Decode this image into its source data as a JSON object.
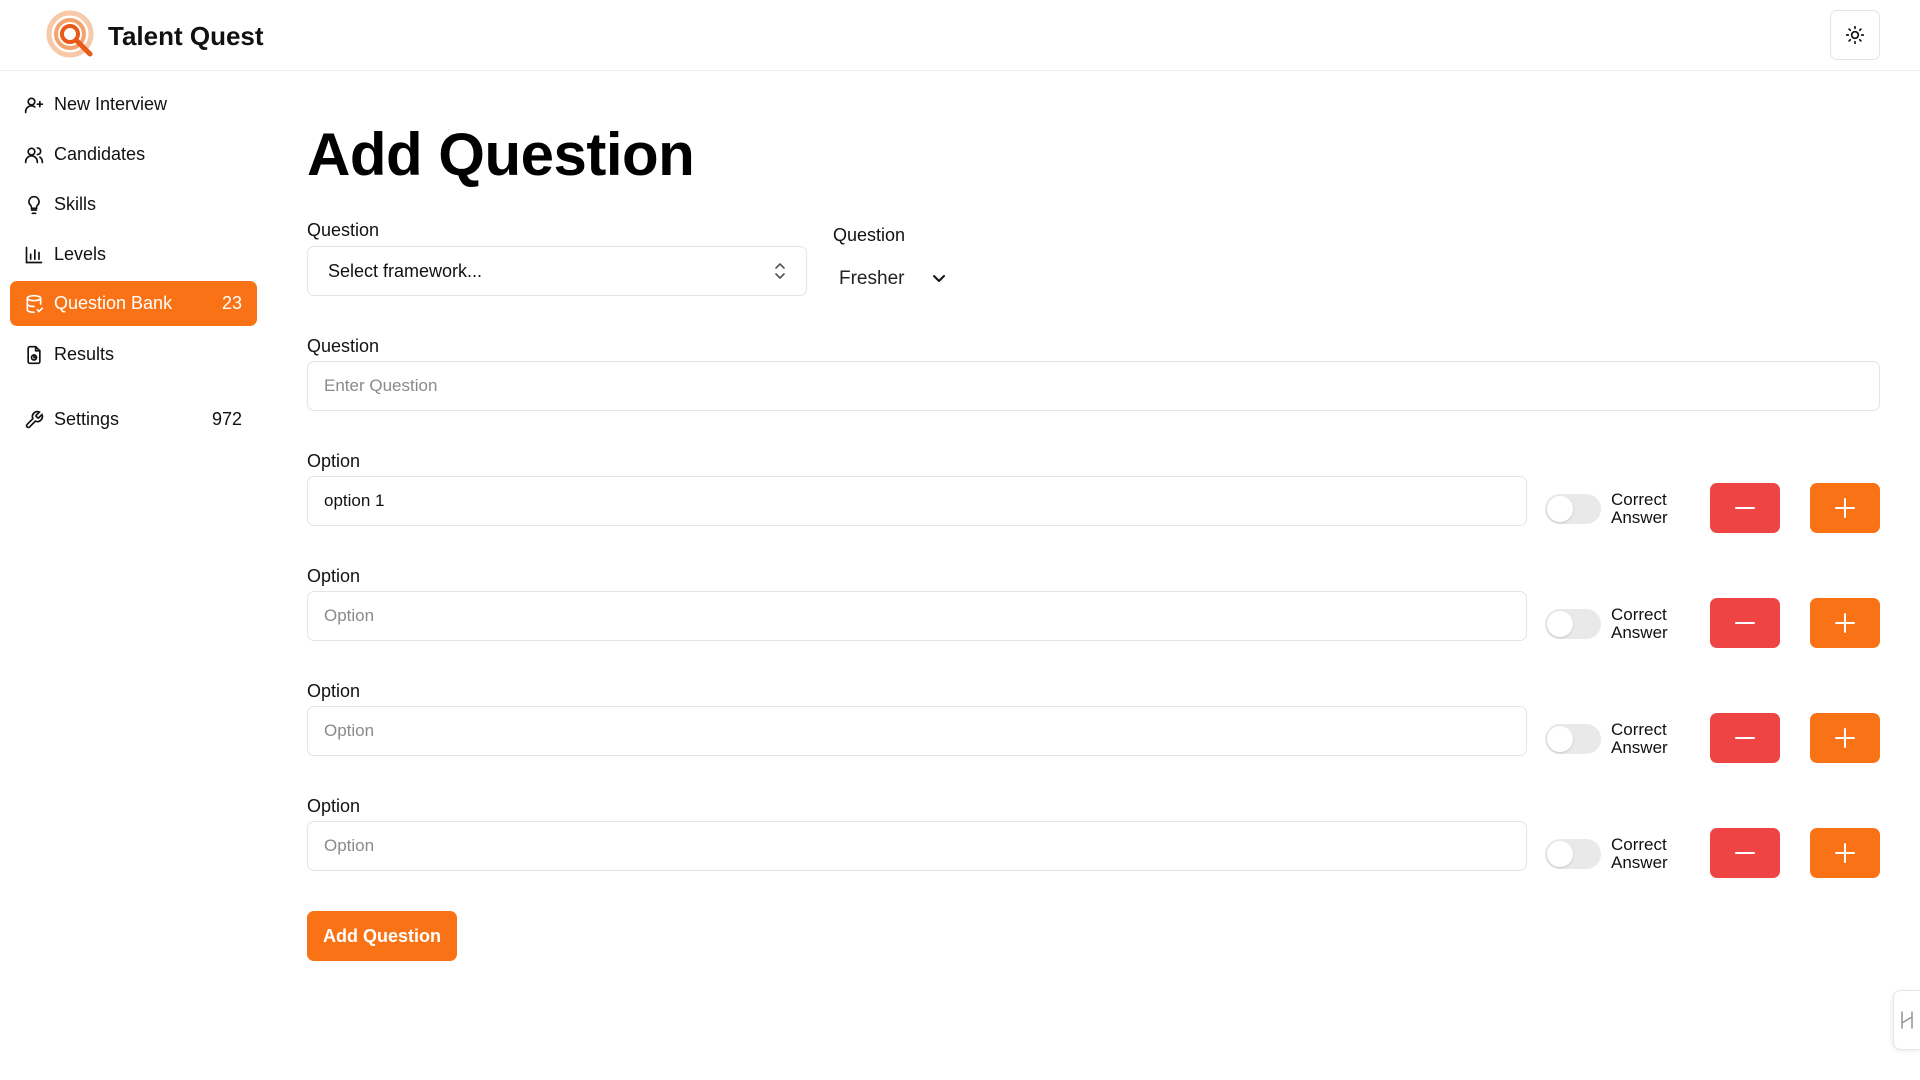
{
  "app": {
    "name": "Talent Quest"
  },
  "sidebar": {
    "items": [
      {
        "label": "New Interview",
        "icon": "user-plus-icon",
        "count": ""
      },
      {
        "label": "Candidates",
        "icon": "users-icon",
        "count": ""
      },
      {
        "label": "Skills",
        "icon": "lightbulb-icon",
        "count": ""
      },
      {
        "label": "Levels",
        "icon": "bar-chart-icon",
        "count": ""
      },
      {
        "label": "Question Bank",
        "icon": "database-icon",
        "count": "23",
        "active": true
      },
      {
        "label": "Results",
        "icon": "file-chart-icon",
        "count": ""
      },
      {
        "label": "Settings",
        "icon": "wrench-icon",
        "count": "972"
      }
    ]
  },
  "page": {
    "title": "Add Question",
    "framework": {
      "label": "Question",
      "placeholder": "Select framework..."
    },
    "level": {
      "label": "Question",
      "value": "Fresher"
    },
    "question": {
      "label": "Question",
      "placeholder": "Enter Question",
      "value": ""
    },
    "options": [
      {
        "label": "Option",
        "value": "option 1",
        "placeholder": "Option",
        "correct_label": "Correct Answer",
        "correct": false
      },
      {
        "label": "Option",
        "value": "",
        "placeholder": "Option",
        "correct_label": "Correct Answer",
        "correct": false
      },
      {
        "label": "Option",
        "value": "",
        "placeholder": "Option",
        "correct_label": "Correct Answer",
        "correct": false
      },
      {
        "label": "Option",
        "value": "",
        "placeholder": "Option",
        "correct_label": "Correct Answer",
        "correct": false
      }
    ],
    "submit_label": "Add Question"
  },
  "colors": {
    "accent": "#f97316",
    "danger": "#ef4444",
    "border": "#e4e4e7"
  }
}
